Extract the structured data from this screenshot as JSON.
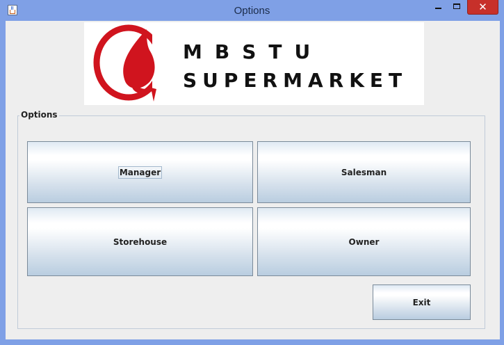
{
  "window": {
    "title": "Options"
  },
  "titlebar_icons": {
    "app": "java-app-icon",
    "minimize": "minimize-icon",
    "maximize": "maximize-icon",
    "close": "close-icon",
    "close_glyph": "✕"
  },
  "banner": {
    "line1": "MBSTU",
    "line2": "SUPERMARKET",
    "logo": "red-flame-logo",
    "logo_color": "#d0141e"
  },
  "options_group": {
    "title": "Options",
    "buttons": {
      "manager": "Manager",
      "salesman": "Salesman",
      "storehouse": "Storehouse",
      "owner": "Owner"
    }
  },
  "exit_button": {
    "label": "Exit"
  },
  "colors": {
    "titlebar": "#7fa0e6",
    "close_button": "#c7302a",
    "client_background": "#eeeeee"
  }
}
